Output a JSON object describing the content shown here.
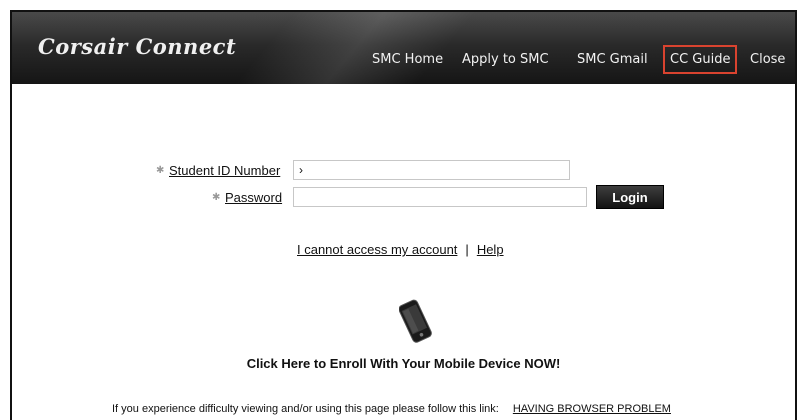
{
  "header": {
    "logo": "Corsair Connect",
    "nav": [
      "SMC Home",
      "Apply to SMC",
      "SMC Gmail",
      "CC Guide",
      "Close"
    ]
  },
  "login": {
    "student_id_label": "Student ID Number",
    "student_id_value": "›",
    "password_label": "Password",
    "password_value": "",
    "login_button": "Login"
  },
  "help_links": {
    "cannot_access": "I cannot access my account",
    "separator": "|",
    "help": "Help"
  },
  "mobile": {
    "enroll_text": "Click Here to Enroll With Your Mobile Device NOW!",
    "icon": "mobile-phone-icon"
  },
  "footer": {
    "text": "If you experience difficulty viewing and/or using this page please follow this link:",
    "link": "HAVING BROWSER PROBLEM"
  },
  "colors": {
    "header_dark": "#151515",
    "highlight_box": "#d9432f",
    "button_dark": "#121212"
  }
}
